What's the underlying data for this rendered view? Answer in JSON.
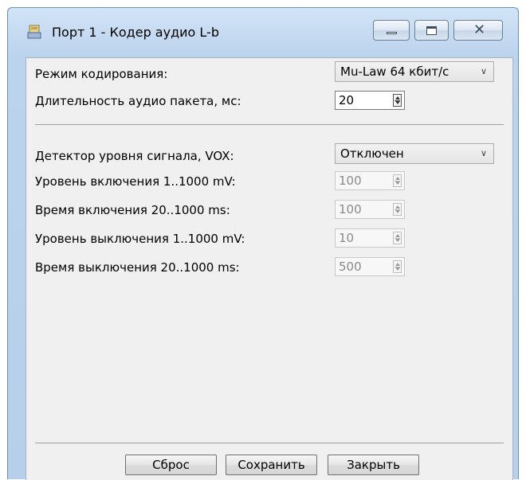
{
  "window": {
    "title": "Порт 1 - Кодер аудио L-b",
    "icon": "app-icon"
  },
  "encoding": {
    "mode_label": "Режим кодирования:",
    "mode_value": "Mu-Law 64 кбит/с",
    "packet_label": "Длительность аудио пакета, мс:",
    "packet_value": "20"
  },
  "vox": {
    "detector_label": "Детектор уровня сигнала, VOX:",
    "detector_value": "Отключен",
    "on_level_label": "Уровень включения 1..1000 mV:",
    "on_level_value": "100",
    "on_time_label": "Время включения 20..1000 ms:",
    "on_time_value": "100",
    "off_level_label": "Уровень выключения 1..1000 mV:",
    "off_level_value": "10",
    "off_time_label": "Время выключения 20..1000 ms:",
    "off_time_value": "500"
  },
  "buttons": {
    "reset": "Сброс",
    "save": "Сохранить",
    "close": "Закрыть"
  }
}
